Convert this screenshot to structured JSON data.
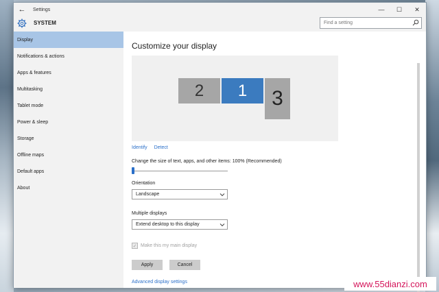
{
  "window": {
    "title": "Settings",
    "back_icon": "back-arrow-icon",
    "minimize": "—",
    "maximize": "☐",
    "close": "✕"
  },
  "header": {
    "title": "SYSTEM",
    "icon": "gear-icon",
    "search_placeholder": "Find a setting"
  },
  "sidebar": {
    "items": [
      {
        "label": "Display",
        "active": true
      },
      {
        "label": "Notifications & actions"
      },
      {
        "label": "Apps & features"
      },
      {
        "label": "Multitasking"
      },
      {
        "label": "Tablet mode"
      },
      {
        "label": "Power & sleep"
      },
      {
        "label": "Storage"
      },
      {
        "label": "Offline maps"
      },
      {
        "label": "Default apps"
      },
      {
        "label": "About"
      }
    ]
  },
  "main": {
    "title": "Customize your display",
    "monitors": [
      {
        "label": "2",
        "selected": false
      },
      {
        "label": "1",
        "selected": true
      },
      {
        "label": "3",
        "selected": false
      }
    ],
    "identify_link": "Identify",
    "detect_link": "Detect",
    "scale_label": "Change the size of text, apps, and other items: 100% (Recommended)",
    "scale_value": 0,
    "orientation_label": "Orientation",
    "orientation_value": "Landscape",
    "multiple_displays_label": "Multiple displays",
    "multiple_displays_value": "Extend desktop to this display",
    "main_display_label": "Make this my main display",
    "main_display_checked": true,
    "main_display_enabled": false,
    "apply_label": "Apply",
    "cancel_label": "Cancel",
    "advanced_link": "Advanced display settings"
  },
  "watermark": "www.55dianzi.com",
  "colors": {
    "accent": "#2a6fc9",
    "selected_nav": "#a8c5e6",
    "monitor_selected": "#3b7bbf",
    "monitor_other": "#a6a6a6",
    "watermark": "#d4145a"
  }
}
